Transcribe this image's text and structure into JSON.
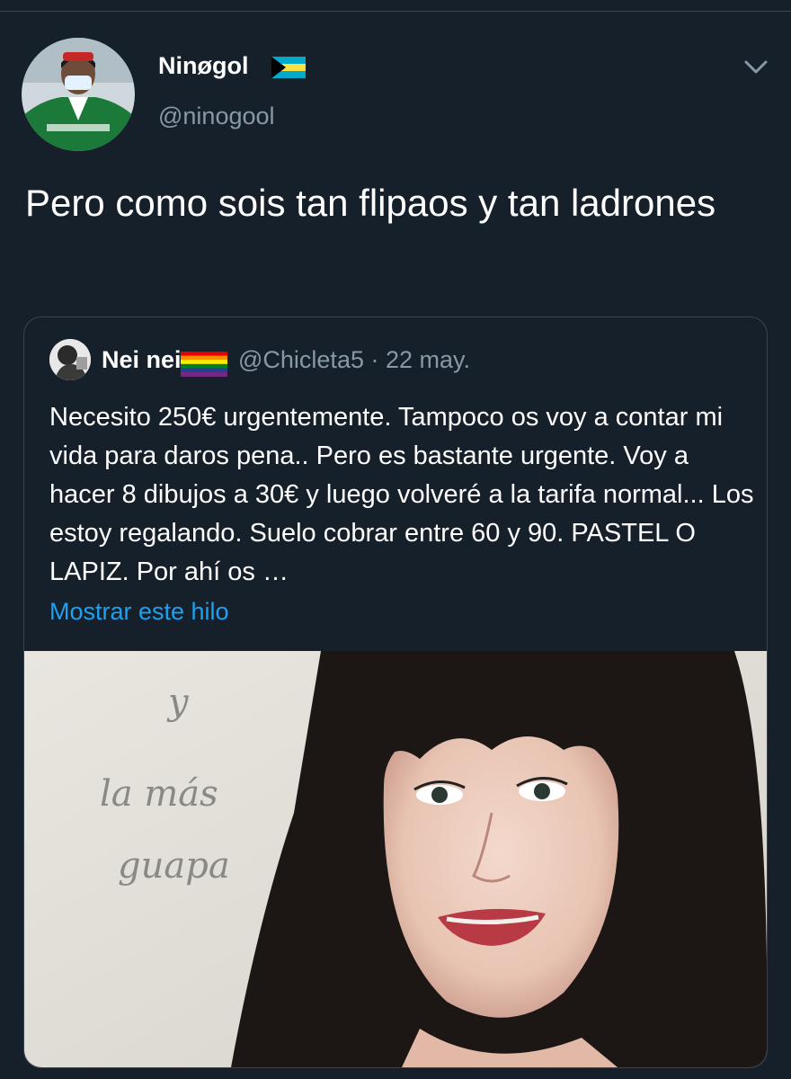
{
  "tweet": {
    "author_name": "Ninøgol",
    "author_handle": "@ninogool",
    "text": "Pero como sois tan flipaos y tan ladrones"
  },
  "quoted_tweet": {
    "author_name": "Nei nei",
    "author_handle": "@Chicleta5",
    "separator": "·",
    "date": "22 may.",
    "text": "Necesito 250€ urgentemente. Tampoco os voy a contar mi vida para daros pena.. Pero es bastante urgente. Voy a hacer 8 dibujos a 30€ y luego volveré a la tarifa normal... Los estoy regalando. Suelo cobrar entre 60 y 90.  PASTEL O LAPIZ. Por ahí os …",
    "show_thread_label": "Mostrar este hilo",
    "image": {
      "handwritten_line1": "y",
      "handwritten_line2": "la más",
      "handwritten_line3": "guapa"
    }
  },
  "icons": {
    "flag": "bahamas-flag-icon",
    "rainbow": "rainbow-flag-icon",
    "menu": "chevron-down-icon"
  },
  "colors": {
    "background": "#15202b",
    "border": "#38444d",
    "secondary_text": "#8899a6",
    "link": "#1da1f2"
  }
}
